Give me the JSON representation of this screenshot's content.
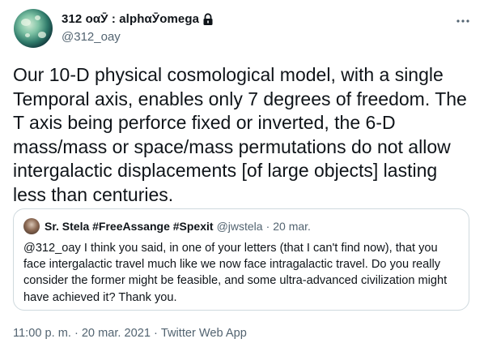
{
  "author": {
    "display_name": "312 οαӮ : alphαӮomega",
    "handle": "@312_oay",
    "verified_lock": "lock-icon"
  },
  "tweet": {
    "text": "Our 10-D physical cosmological model, with a single Temporal axis, enables only 7 degrees of freedom. The T axis being perforce fixed or inverted, the 6-D mass/mass or space/mass permutations do not allow intergalactic displacements [of large objects] lasting less than centuries."
  },
  "quote": {
    "name": "Sr. Stela #FreeAssange #Spexit",
    "handle": "@jwstela",
    "separator": "·",
    "time": "20 mar.",
    "text": "@312_oay I think you said, in one of your letters (that I can't find now), that you face intergalactic travel much like we now face intragalactic travel. Do you really consider the former might be feasible, and some ultra-advanced civilization might have achieved it? Thank you."
  },
  "meta": {
    "time": "11:00 p. m.",
    "date": "20 mar. 2021",
    "source": "Twitter Web App",
    "separator": "·"
  },
  "colors": {
    "text": "#0f1419",
    "secondary": "#536471",
    "border": "#cfd9de"
  }
}
